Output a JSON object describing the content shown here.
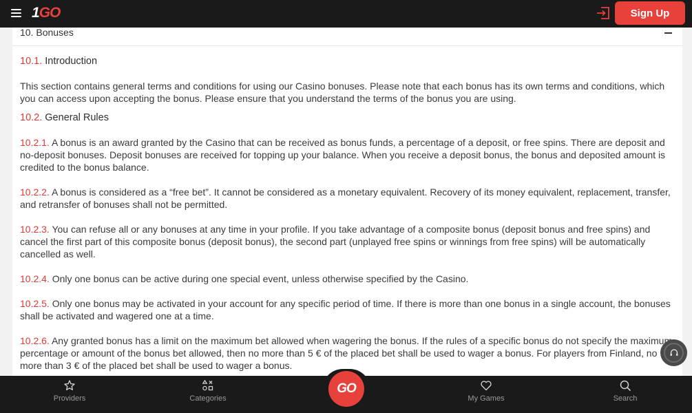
{
  "header": {
    "logo_one": "1",
    "logo_go": "GO",
    "signup_label": "Sign Up"
  },
  "section": {
    "title": "10. Bonuses",
    "intro_num": "10.1.",
    "intro_title": "Introduction",
    "intro_text": "This section contains general terms and conditions for using our Casino bonuses. Please note that each bonus has its own terms and conditions, which you can access upon accepting the bonus. Please ensure that you understand the terms of the bonus you are using.",
    "rules_num": "10.2.",
    "rules_title": "General Rules",
    "items": [
      {
        "num": "10.2.1.",
        "text": "A bonus is an award granted by the Casino that can be received as bonus funds, a percentage of a deposit, or free spins. There are deposit and no-deposit bonuses. Deposit bonuses are received for topping up your balance. When you receive a deposit bonus, the bonus and deposited amount is credited to the bonus balance."
      },
      {
        "num": "10.2.2.",
        "text": "A bonus is considered as a “free bet”. It cannot be considered as a monetary equivalent. Recovery of its money equivalent, replacement, transfer, and retransfer of bonuses shall not be permitted."
      },
      {
        "num": "10.2.3.",
        "text": "You can refuse all or any bonuses at any time in your profile. If you take advantage of a composite bonus (deposit bonus and free spins) and cancel the first part of this composite bonus (deposit bonus), the second part (unplayed free spins or winnings from free spins) will be automatically cancelled as well."
      },
      {
        "num": "10.2.4.",
        "text": "Only one bonus can be active during one special event, unless otherwise specified by the Casino."
      },
      {
        "num": "10.2.5.",
        "text": "Only one bonus may be activated in your account for any specific period of time. If there is more than one bonus in a single account, the bonuses shall be activated and wagered one at a time."
      },
      {
        "num": "10.2.6.",
        "text": "Any granted bonus has a limit on the maximum bet allowed when wagering the bonus. If the rules of a specific bonus do not specify the maximum percentage or amount of the bonus bet allowed, then no more than 5 € of the placed bet shall be used to wager a bonus. For players from Finland, no more than 3 € of the placed bet shall be used to wager a bonus."
      }
    ]
  },
  "bottom_nav": {
    "providers": "Providers",
    "categories": "Categories",
    "go": "GO",
    "my_games": "My Games",
    "search": "Search"
  },
  "colors": {
    "accent": "#e8403a",
    "bar": "#1a1a1a"
  }
}
